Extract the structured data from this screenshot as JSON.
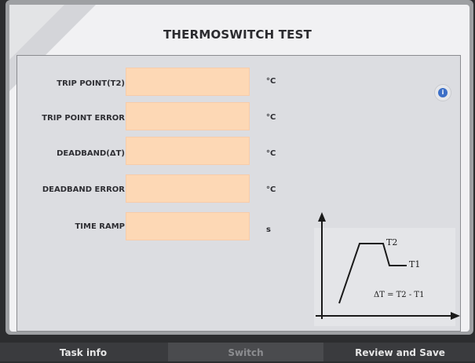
{
  "title": "THERMOSWITCH TEST",
  "fields": [
    {
      "label": "TRIP POINT(T2)",
      "value": "",
      "unit": "°C"
    },
    {
      "label": "TRIP POINT ERROR",
      "value": "",
      "unit": "°C"
    },
    {
      "label": "DEADBAND(ΔT)",
      "value": "",
      "unit": "°C"
    },
    {
      "label": "DEADBAND ERROR",
      "value": "",
      "unit": "°C"
    },
    {
      "label": "TIME RAMP",
      "value": "",
      "unit": "s"
    }
  ],
  "graph": {
    "label_t2": "T2",
    "label_t1": "T1",
    "formula": "ΔT = T2 - T1"
  },
  "info_icon": "info-icon",
  "tabs": {
    "task_info": "Task info",
    "switch": "Switch",
    "review_save": "Review and Save"
  },
  "colors": {
    "field_bg": "#fdd8b5",
    "panel_bg": "#dcdde1",
    "info_accent": "#3c6fc7"
  }
}
